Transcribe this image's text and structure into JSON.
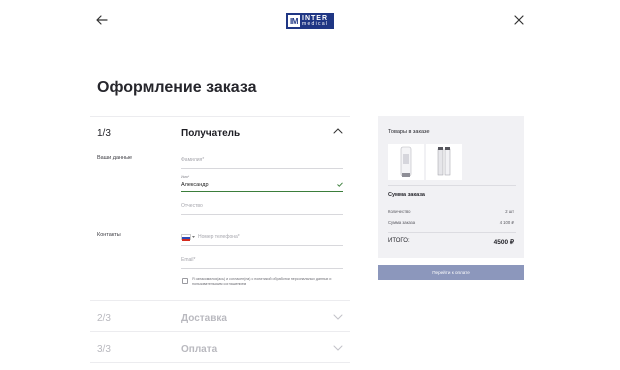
{
  "logo": {
    "mark": "IM",
    "line1": "INTER",
    "line2": "medical"
  },
  "title": "Оформление заказа",
  "steps": [
    {
      "number": "1/3",
      "title": "Получатель"
    },
    {
      "number": "2/3",
      "title": "Доставка"
    },
    {
      "number": "3/3",
      "title": "Оплата"
    }
  ],
  "recipient": {
    "section_label": "Ваши данные",
    "surname_placeholder": "Фамилия*",
    "name_label": "Имя*",
    "name_value": "Александр",
    "patronymic_placeholder": "Отчество"
  },
  "contacts": {
    "section_label": "Контакты",
    "phone_placeholder": "Номер телефона*",
    "email_placeholder": "Email*",
    "consent_text": "Я ознакомился(ась) и согласен(на) с политикой обработки персональных данных и пользовательским соглашением"
  },
  "summary": {
    "items_title": "Товары в заказе",
    "sum_title": "Сумма заказа",
    "rows": [
      {
        "label": "Количество",
        "value": "2 шт"
      },
      {
        "label": "Сумма заказа",
        "value": "4 100 ₽"
      }
    ],
    "total_label": "ИТОГО:",
    "total_value": "4500 ₽"
  },
  "pay_button": "Перейти к оплате",
  "colors": {
    "accent": "#1f3684",
    "button": "#8c97bc",
    "valid": "#3b7e3b",
    "panel": "#f1f1f4"
  }
}
